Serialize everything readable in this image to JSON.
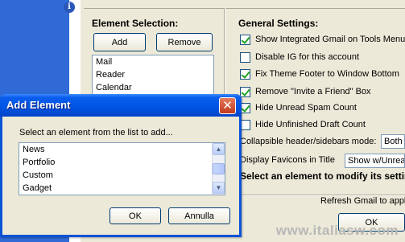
{
  "element_selection": {
    "title": "Element Selection:",
    "add_label": "Add",
    "remove_label": "Remove",
    "items": [
      "Mail",
      "Reader",
      "Calendar"
    ]
  },
  "general_settings": {
    "title": "General Settings:",
    "options": [
      {
        "label": "Show Integrated Gmail on Tools Menu",
        "checked": true
      },
      {
        "label": "Disable IG for this account",
        "checked": false
      },
      {
        "label": "Fix Theme Footer to Window Bottom",
        "checked": true
      },
      {
        "label": "Remove \"Invite a Friend\" Box",
        "checked": true
      },
      {
        "label": "Hide Unread Spam Count",
        "checked": true
      },
      {
        "label": "Hide Unfinished Draft Count",
        "checked": false
      }
    ],
    "collapsible_label": "Collapsible header/sidebars mode:",
    "collapsible_value": "Both",
    "favicons_label": "Display Favicons in Title",
    "favicons_value": "Show w/Unread",
    "hint": "Select an element to modify its settings"
  },
  "footer": {
    "refresh_text": "Refresh Gmail to apply",
    "ok_label": "OK"
  },
  "dialog": {
    "title": "Add Element",
    "prompt": "Select an element from the list to add...",
    "items": [
      "News",
      "Portfolio",
      "Custom",
      "Gadget"
    ],
    "ok_label": "OK",
    "cancel_label": "Annulla",
    "close_glyph": "✕"
  },
  "watermark": "www.italiasw.com",
  "info_glyph": "i"
}
